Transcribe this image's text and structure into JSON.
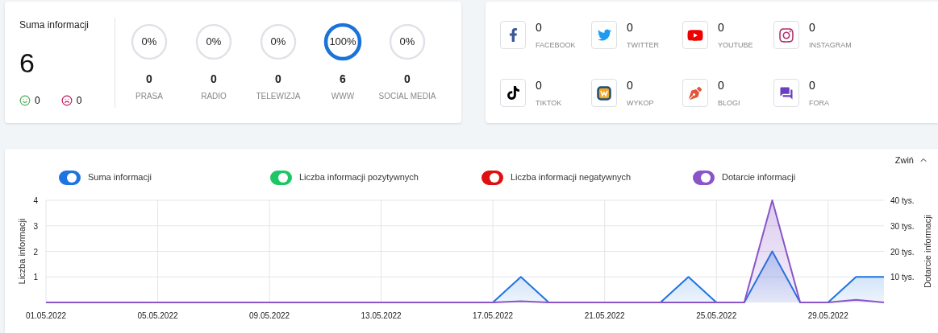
{
  "summary": {
    "title": "Suma informacji",
    "total": "6",
    "positive": "0",
    "negative": "0"
  },
  "channels": [
    {
      "percent": "0%",
      "count": "0",
      "label": "PRASA"
    },
    {
      "percent": "0%",
      "count": "0",
      "label": "RADIO"
    },
    {
      "percent": "0%",
      "count": "0",
      "label": "TELEWIZJA"
    },
    {
      "percent": "100%",
      "count": "6",
      "label": "WWW"
    },
    {
      "percent": "0%",
      "count": "0",
      "label": "SOCIAL MEDIA"
    }
  ],
  "social": [
    {
      "count": "0",
      "label": "FACEBOOK"
    },
    {
      "count": "0",
      "label": "TWITTER"
    },
    {
      "count": "0",
      "label": "YOUTUBE"
    },
    {
      "count": "0",
      "label": "INSTAGRAM"
    },
    {
      "count": "0",
      "label": "TIKTOK"
    },
    {
      "count": "0",
      "label": "WYKOP"
    },
    {
      "count": "0",
      "label": "BLOGI"
    },
    {
      "count": "0",
      "label": "FORA"
    }
  ],
  "collapse": {
    "label": "Zwiń"
  },
  "legend": [
    {
      "on": true
    },
    {
      "on": true
    },
    {
      "on": true
    },
    {
      "on": true
    }
  ],
  "chart_data": {
    "type": "area",
    "grid": true,
    "legend": "top",
    "ylabel": "Liczba informacji",
    "y2label": "Dotarcie informacji",
    "categories": [
      "01.05.2022",
      null,
      null,
      null,
      "05.05.2022",
      null,
      null,
      null,
      "09.05.2022",
      null,
      null,
      null,
      "13.05.2022",
      null,
      null,
      null,
      "17.05.2022",
      null,
      null,
      null,
      "21.05.2022",
      null,
      null,
      null,
      "25.05.2022",
      null,
      null,
      null,
      "29.05.2022",
      null,
      null
    ],
    "ylim": [
      0,
      4
    ],
    "yticks": [
      1,
      2,
      3,
      4
    ],
    "y2lim": [
      0,
      40
    ],
    "y2ticks": [
      {
        "value": 10,
        "label": "10 tys."
      },
      {
        "value": 20,
        "label": "20 tys."
      },
      {
        "value": 30,
        "label": "30 tys."
      },
      {
        "value": 40,
        "label": "40 tys."
      }
    ],
    "series": [
      {
        "name": "Suma informacji",
        "color": "#1e74e0",
        "values": [
          null,
          null,
          null,
          null,
          null,
          null,
          null,
          null,
          null,
          null,
          null,
          null,
          null,
          null,
          null,
          null,
          0,
          1,
          0,
          null,
          null,
          null,
          0,
          1,
          0,
          0,
          2,
          0,
          0,
          1,
          1
        ]
      },
      {
        "name": "Liczba informacji pozytywnych",
        "color": "#1ec765",
        "values": [
          null,
          null,
          null,
          null,
          null,
          null,
          null,
          null,
          null,
          null,
          null,
          null,
          null,
          null,
          null,
          null,
          null,
          null,
          null,
          null,
          null,
          null,
          null,
          null,
          null,
          null,
          null,
          null,
          null,
          null,
          null
        ]
      },
      {
        "name": "Liczba informacji negatywnych",
        "color": "#e01010",
        "values": [
          null,
          null,
          null,
          null,
          null,
          null,
          null,
          null,
          null,
          null,
          null,
          null,
          null,
          null,
          null,
          null,
          null,
          null,
          null,
          null,
          null,
          null,
          null,
          null,
          null,
          null,
          null,
          null,
          null,
          null,
          null
        ]
      },
      {
        "name": "Dotarcie informacji",
        "color": "#8a55c8",
        "axis": "y2",
        "values": [
          0,
          0,
          0,
          0,
          0,
          0,
          0,
          0,
          0,
          0,
          0,
          0,
          0,
          0,
          0,
          0,
          0,
          0.5,
          0,
          0,
          0,
          0,
          0,
          0,
          0,
          0,
          40,
          0,
          0,
          1,
          0
        ]
      }
    ]
  }
}
